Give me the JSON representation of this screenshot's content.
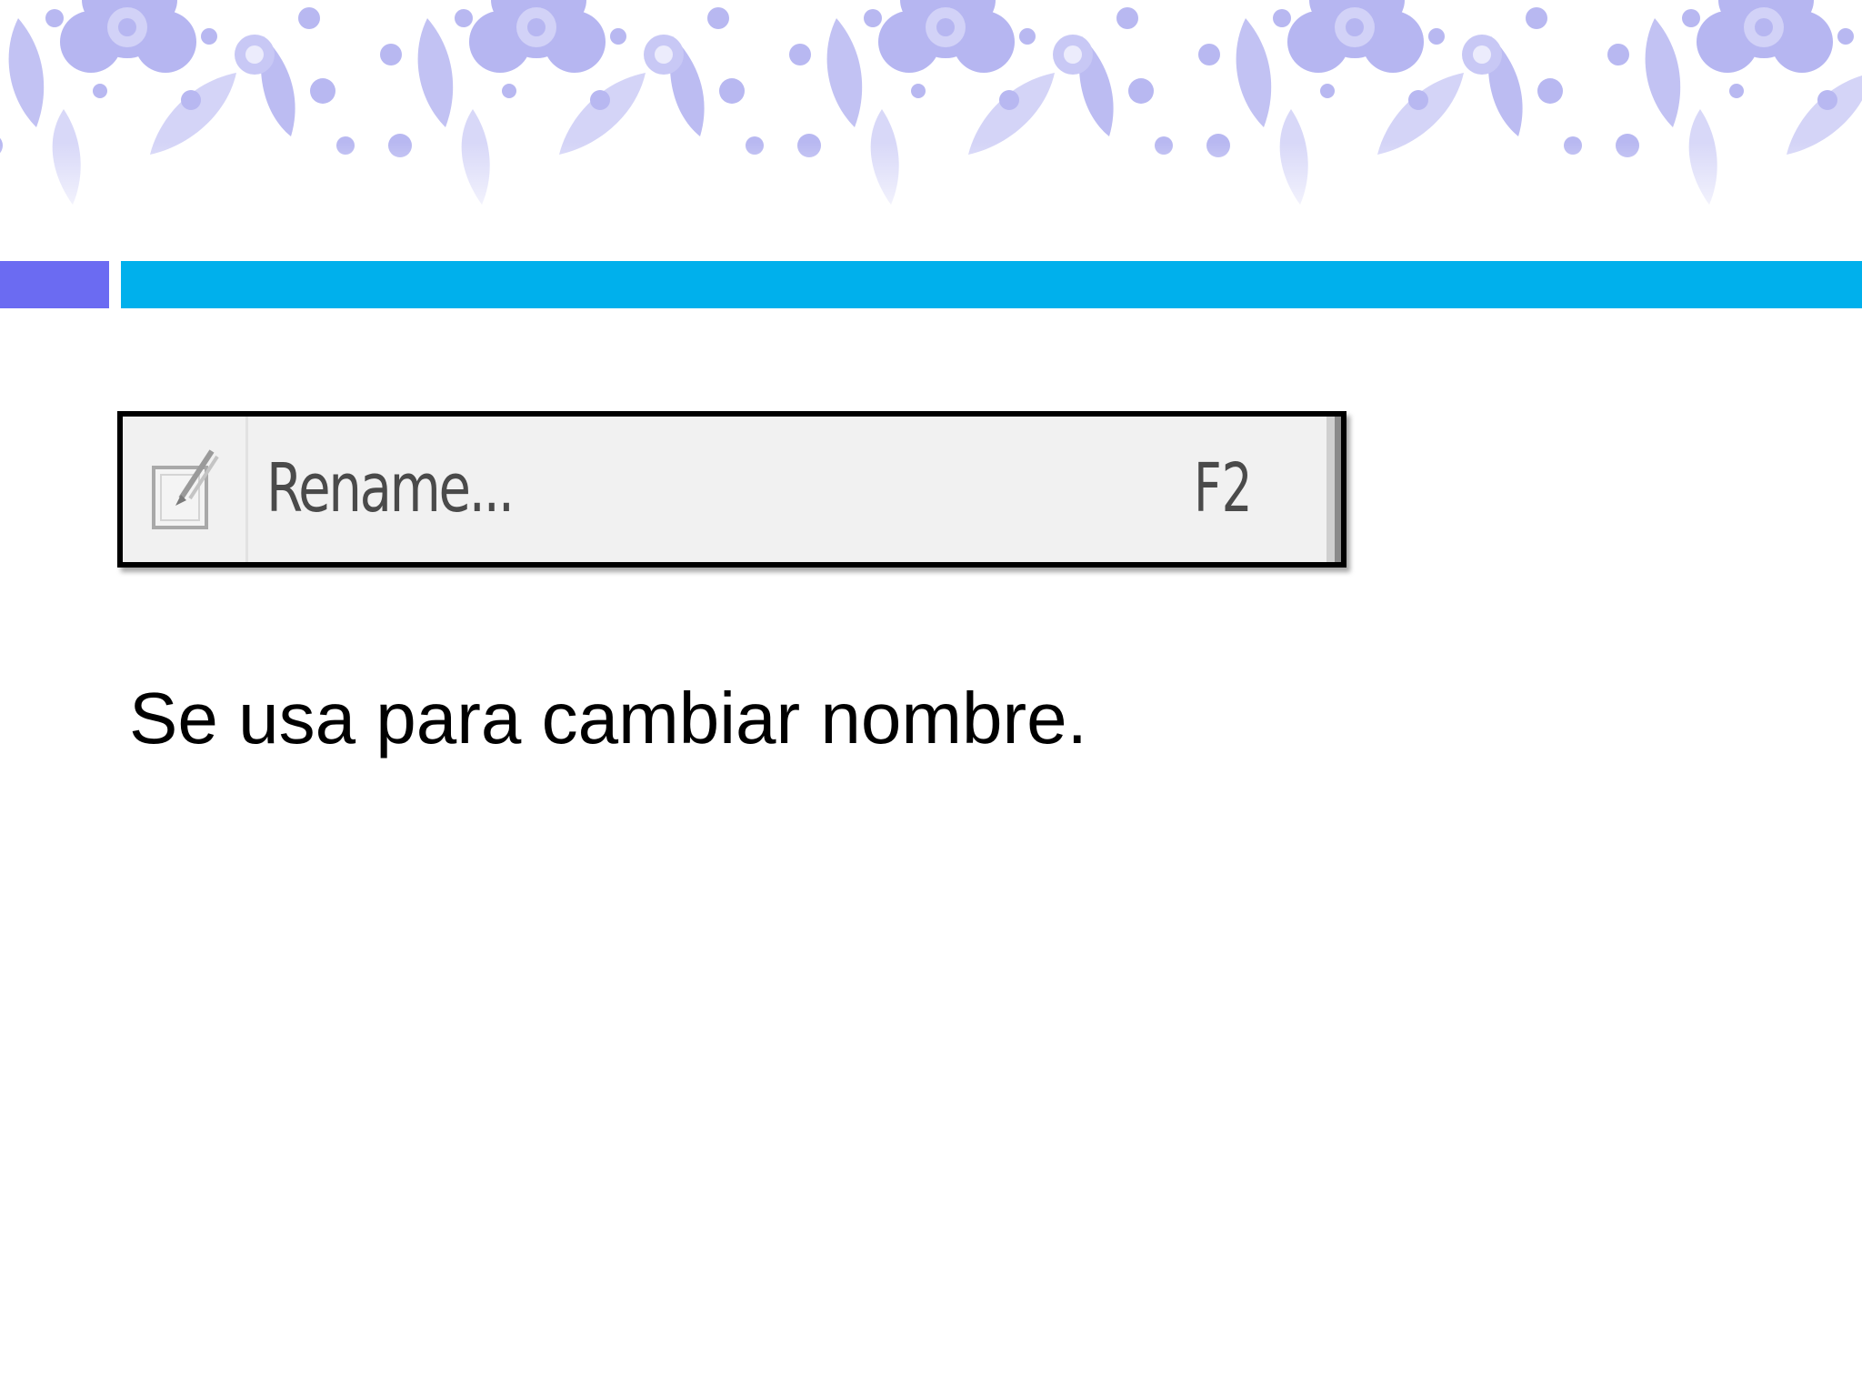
{
  "slide": {
    "menu_item": {
      "icon": "rename-icon",
      "label": "Rename...",
      "shortcut": "F2"
    },
    "caption": "Se usa para cambiar nombre."
  },
  "colors": {
    "banner_motif": "#b4b4f0",
    "banner_motif_light": "#d8d8f6",
    "accent_left": "#6b6bf2",
    "accent_main": "#00b0ec",
    "menu_background": "#f1f1f1",
    "menu_text": "#4a4a4a"
  }
}
